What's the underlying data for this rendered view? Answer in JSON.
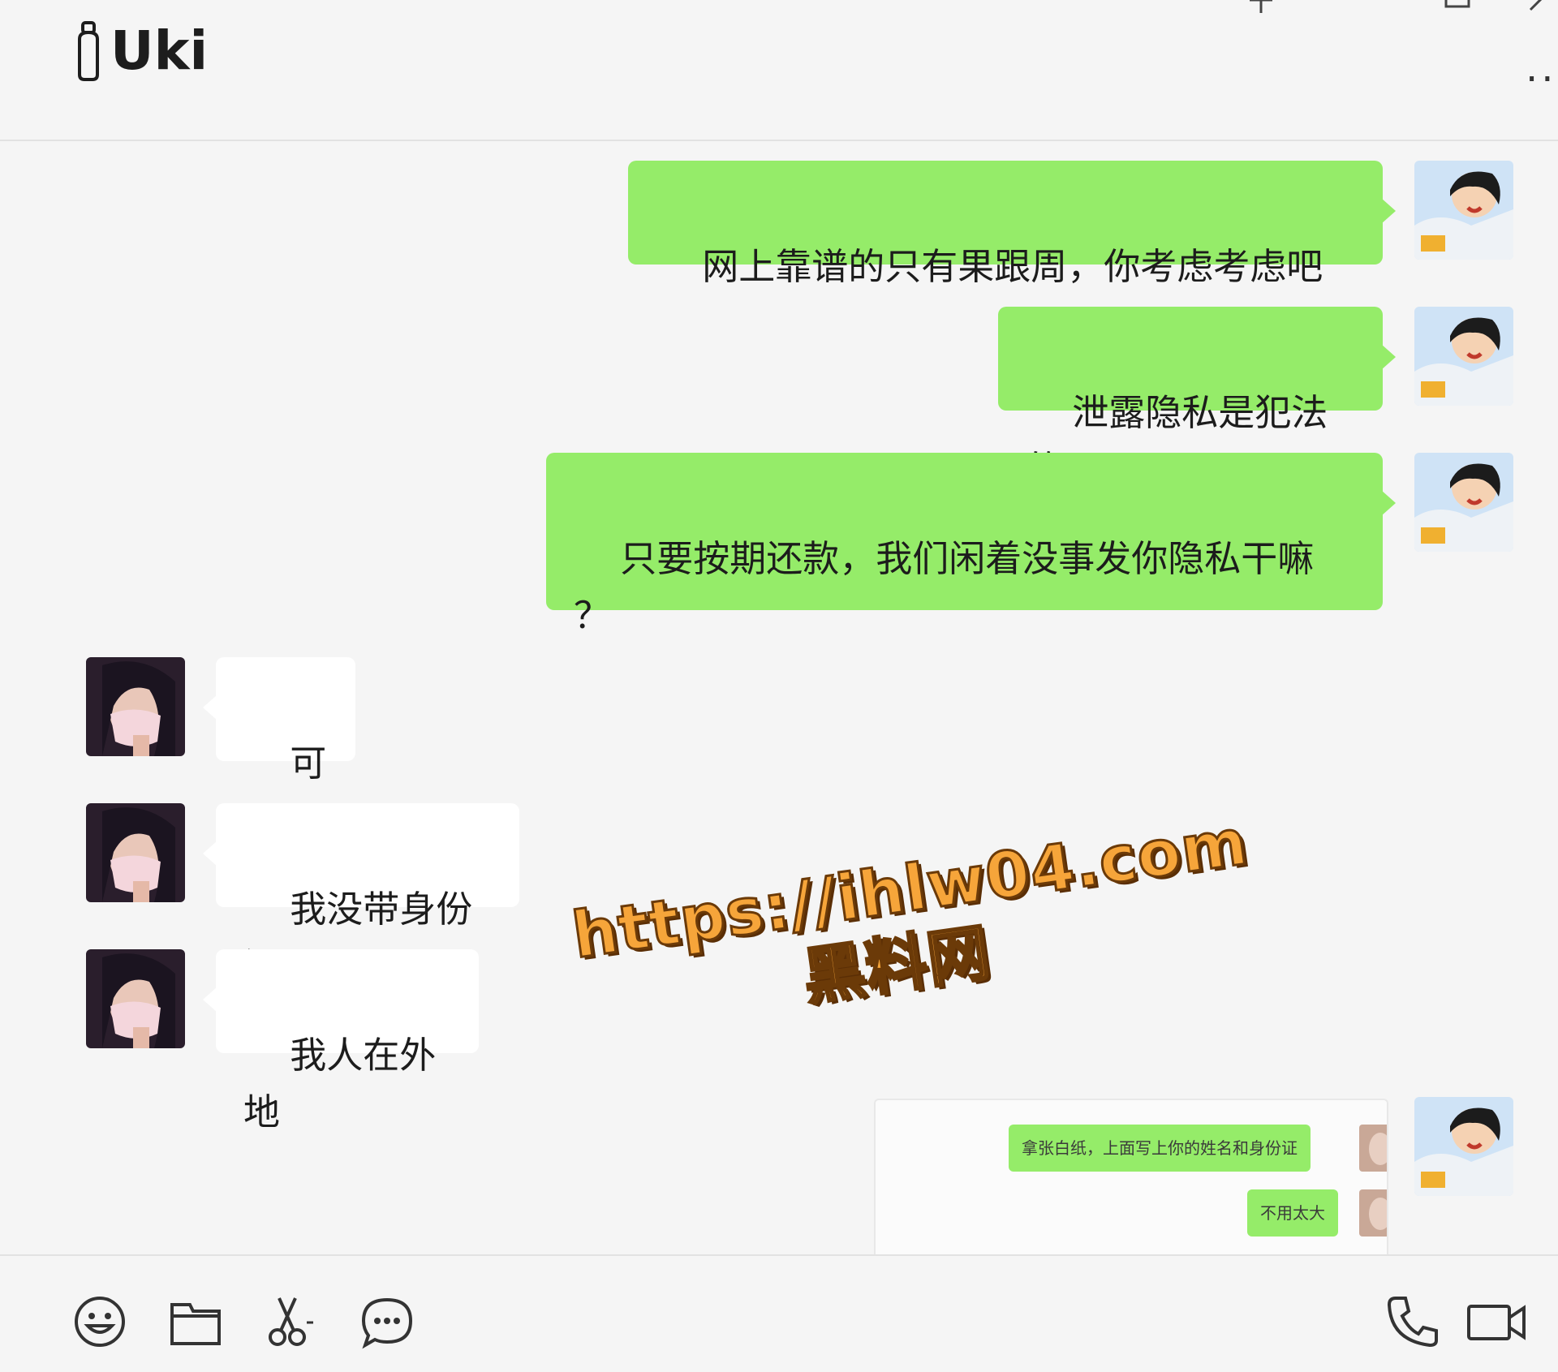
{
  "header": {
    "title": "Uki"
  },
  "messages": [
    {
      "side": "out",
      "text": "网上靠谱的只有果跟周，你考虑考虑吧"
    },
    {
      "side": "out",
      "text": "泄露隐私是犯法的"
    },
    {
      "side": "out",
      "text": "只要按期还款，我们闲着没事发你隐私干嘛\n？"
    },
    {
      "side": "in",
      "text": "可是"
    },
    {
      "side": "in",
      "text": "我没带身份证"
    },
    {
      "side": "in",
      "text": "我人在外地"
    }
  ],
  "image_message": {
    "line1": "拿张白纸，上面写上你的姓名和身份证",
    "line2": "不用太大"
  },
  "watermark": {
    "url": "https://ihlw04.com",
    "site_name": "黑料网"
  },
  "toolbar": {
    "icons": [
      "emoji-icon",
      "folder-icon",
      "scissors-icon",
      "chat-history-icon",
      "phone-icon",
      "video-call-icon"
    ]
  },
  "colors": {
    "outgoing_bubble": "#95ec69",
    "incoming_bubble": "#ffffff",
    "background": "#f5f5f5",
    "watermark": "#f6a53a"
  }
}
